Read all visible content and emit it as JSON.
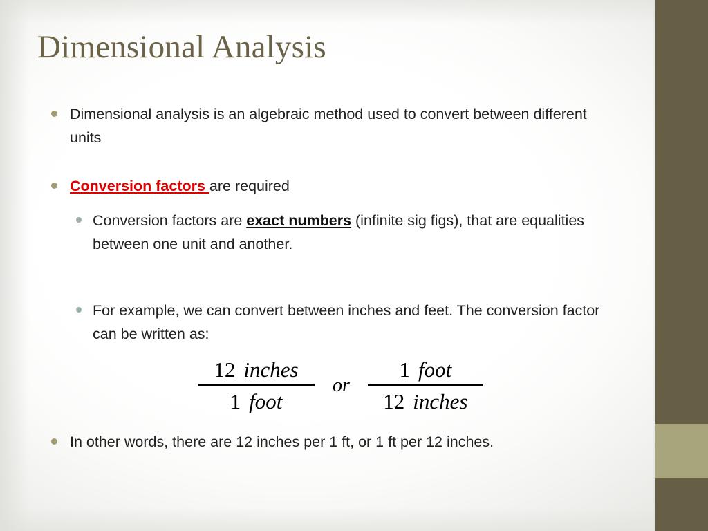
{
  "slide": {
    "title": "Dimensional Analysis",
    "colors": {
      "title": "#6b6348",
      "body_text": "#222222",
      "bullet_level1": "#a39b72",
      "bullet_level2": "#9bb1a8",
      "accent_red": "#e00000",
      "side_bar_dark": "#665f46",
      "side_bar_light": "#a8a47c",
      "background": "#ffffff"
    }
  },
  "body": {
    "bullet_1": {
      "text": "Dimensional analysis is an algebraic method used to convert between different units"
    },
    "bullet_2": {
      "emphasis": "Conversion factors ",
      "rest": "are required"
    },
    "sub_bullet_1": {
      "before": "Conversion factors are ",
      "emphasis": "exact numbers",
      "after": " (infinite sig figs), that are equalities between one unit and another."
    },
    "sub_bullet_2": {
      "text": "For example, we can convert between inches and feet.   The conversion factor can be written as:"
    },
    "bullet_3": {
      "text": "In other words, there are 12 inches per 1 ft, or 1 ft per 12 inches."
    }
  },
  "equation": {
    "fraction_left": {
      "numerator_number": "12",
      "numerator_unit": "inches",
      "denominator_number": "1",
      "denominator_unit": "foot"
    },
    "connector": "or",
    "fraction_right": {
      "numerator_number": "1",
      "numerator_unit": "foot",
      "denominator_number": "12",
      "denominator_unit": "inches"
    }
  }
}
